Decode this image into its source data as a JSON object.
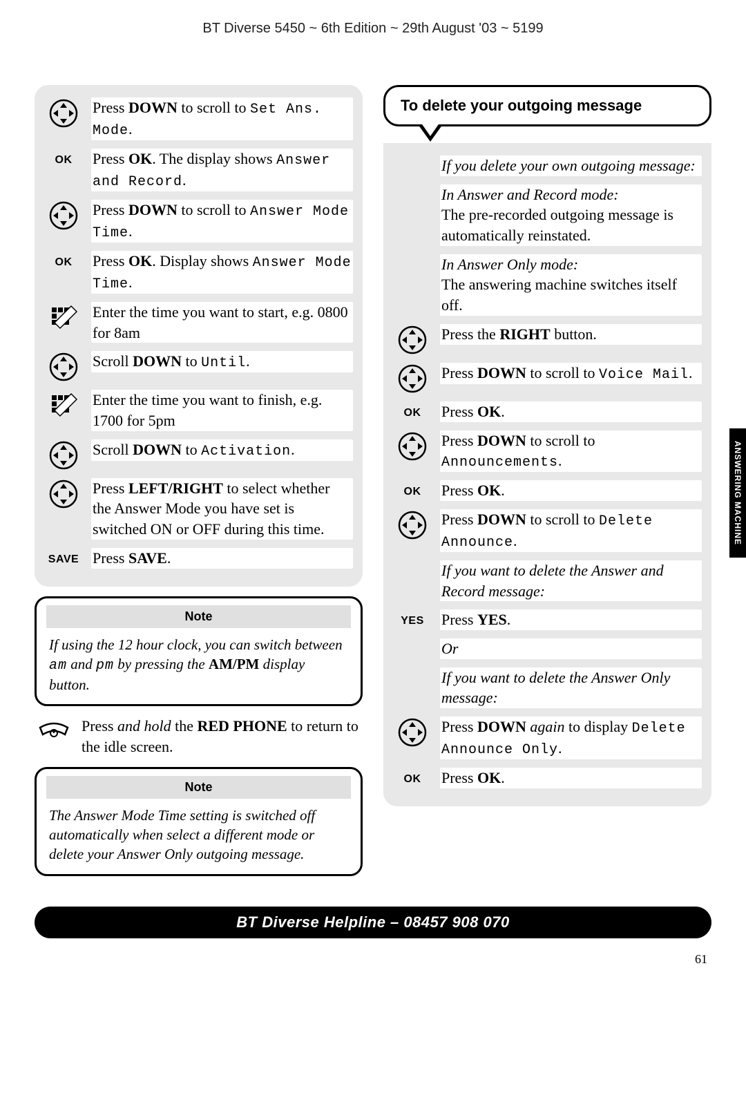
{
  "header": "BT Diverse 5450 ~ 6th Edition ~ 29th August '03 ~ 5199",
  "left": {
    "steps": [
      {
        "icon": "nav",
        "pre": "Press ",
        "bold": "DOWN",
        "post": " to scroll to ",
        "lcd": "Set Ans. Mode",
        "tail": "."
      },
      {
        "icon": "ok",
        "ok": "OK",
        "pre": "Press ",
        "bold": "OK",
        "post": ". The display shows ",
        "lcd": "Answer and Record",
        "tail": "."
      },
      {
        "icon": "nav",
        "pre": "Press ",
        "bold": "DOWN",
        "post": " to scroll to ",
        "lcd": "Answer Mode Time",
        "tail": "."
      },
      {
        "icon": "ok",
        "ok": "OK",
        "pre": "Press ",
        "bold": "OK",
        "post": ". Display shows ",
        "lcd": "Answer Mode Time",
        "tail": "."
      },
      {
        "icon": "keypad",
        "plain": "Enter the time you want to start, e.g. 0800 for 8am"
      },
      {
        "icon": "nav",
        "pre": "Scroll ",
        "bold": "DOWN",
        "post": " to ",
        "lcd": "Until",
        "tail": "."
      },
      {
        "icon": "keypad",
        "plain": "Enter the time you want to finish, e.g. 1700 for 5pm"
      },
      {
        "icon": "nav",
        "pre": "Scroll ",
        "bold": "DOWN",
        "post": " to ",
        "lcd": "Activation",
        "tail": "."
      },
      {
        "icon": "nav",
        "pre": "Press ",
        "bold": "LEFT/RIGHT",
        "post": " to select whether the Answer Mode you have set is switched ON or OFF during this time."
      },
      {
        "icon": "ok",
        "ok": "SAVE",
        "pre": "Press ",
        "bold": "SAVE",
        "post": "."
      }
    ],
    "note1_title": "Note",
    "note1_body_a": "If using the 12 hour clock, you can switch between ",
    "note1_lcd1": "am",
    "note1_mid": " and ",
    "note1_lcd2": "pm",
    "note1_body_b": " by pressing the ",
    "note1_bold": "AM/PM",
    "note1_body_c": " display button.",
    "hang_pre": "Press ",
    "hang_ital": "and hold",
    "hang_mid": " the ",
    "hang_bold": "RED PHONE",
    "hang_post": " to return to the idle screen.",
    "note2_title": "Note",
    "note2_body": "The Answer Mode Time setting is switched off automatically when select a different mode or delete your Answer Only outgoing message."
  },
  "right": {
    "callout": "To delete your outgoing message",
    "intro_ital": "If you delete your own outgoing message:",
    "sec1_ital": "In Answer and Record mode:",
    "sec1_body": "The pre-recorded outgoing message is automatically reinstated.",
    "sec2_ital": "In Answer Only mode:",
    "sec2_body": "The answering machine switches itself off.",
    "steps": [
      {
        "icon": "nav",
        "pre": "Press the ",
        "bold": "RIGHT",
        "post": " button."
      },
      {
        "icon": "nav",
        "pre": "Press ",
        "bold": "DOWN",
        "post": " to scroll to ",
        "lcd": "Voice Mail",
        "tail": "."
      },
      {
        "icon": "ok",
        "ok": "OK",
        "pre": "Press ",
        "bold": "OK",
        "post": "."
      },
      {
        "icon": "nav",
        "pre": "Press ",
        "bold": "DOWN",
        "post": " to scroll to ",
        "lcd": "Announcements",
        "tail": "."
      },
      {
        "icon": "ok",
        "ok": "OK",
        "pre": "Press ",
        "bold": "OK",
        "post": "."
      },
      {
        "icon": "nav",
        "pre": "Press ",
        "bold": "DOWN",
        "post": " to scroll to ",
        "lcd": "Delete Announce",
        "tail": "."
      }
    ],
    "if1": "If you want to delete the Answer and Record message:",
    "yes_label": "YES",
    "yes_pre": "Press ",
    "yes_bold": "YES",
    "yes_post": ".",
    "or": "Or",
    "if2": "If you want to delete the Answer Only message:",
    "down_again_pre": "Press ",
    "down_again_bold": "DOWN",
    "down_again_ital": " again",
    "down_again_post": " to display ",
    "down_again_lcd": "Delete Announce Only",
    "down_again_tail": ".",
    "ok_final_label": "OK",
    "ok_final_pre": "Press ",
    "ok_final_bold": "OK",
    "ok_final_post": "."
  },
  "side_tab": "ANSWERING MACHINE",
  "footer": "BT Diverse Helpline – 08457 908 070",
  "page_number": "61"
}
